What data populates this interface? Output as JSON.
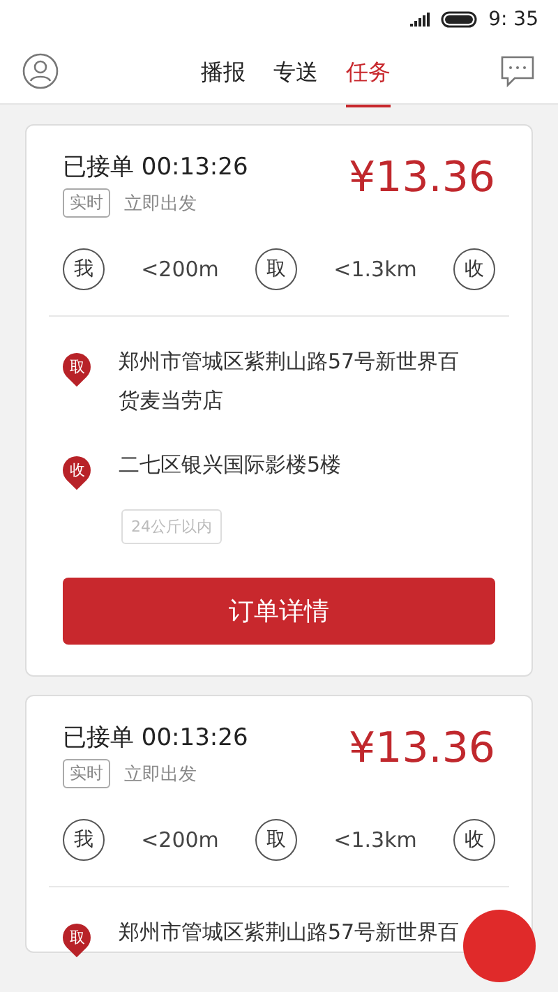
{
  "status_bar": {
    "time": "9: 35"
  },
  "header": {
    "tabs": [
      {
        "label": "播报",
        "selected": false
      },
      {
        "label": "专送",
        "selected": false
      },
      {
        "label": "任务",
        "selected": true
      }
    ]
  },
  "orders": [
    {
      "status": "已接单",
      "timer": "00:13:26",
      "price": "¥13.36",
      "tag": "实时",
      "departure": "立即出发",
      "route": [
        {
          "kind": "stop",
          "label": "我"
        },
        {
          "kind": "distance",
          "label": "<200m"
        },
        {
          "kind": "stop",
          "label": "取"
        },
        {
          "kind": "distance",
          "label": "<1.3km"
        },
        {
          "kind": "stop",
          "label": "收"
        }
      ],
      "addresses": [
        {
          "marker": "取",
          "text": "郑州市管城区紫荆山路57号新世界百货麦当劳店"
        },
        {
          "marker": "收",
          "text": "二七区银兴国际影楼5楼"
        }
      ],
      "weight": "24公斤以内",
      "button": "订单详情"
    },
    {
      "status": "已接单",
      "timer": "00:13:26",
      "price": "¥13.36",
      "tag": "实时",
      "departure": "立即出发",
      "route": [
        {
          "kind": "stop",
          "label": "我"
        },
        {
          "kind": "distance",
          "label": "<200m"
        },
        {
          "kind": "stop",
          "label": "取"
        },
        {
          "kind": "distance",
          "label": "<1.3km"
        },
        {
          "kind": "stop",
          "label": "收"
        }
      ],
      "addresses": [
        {
          "marker": "取",
          "text": "郑州市管城区紫荆山路57号新世界百"
        }
      ]
    }
  ],
  "fab": {
    "kind": "round"
  }
}
